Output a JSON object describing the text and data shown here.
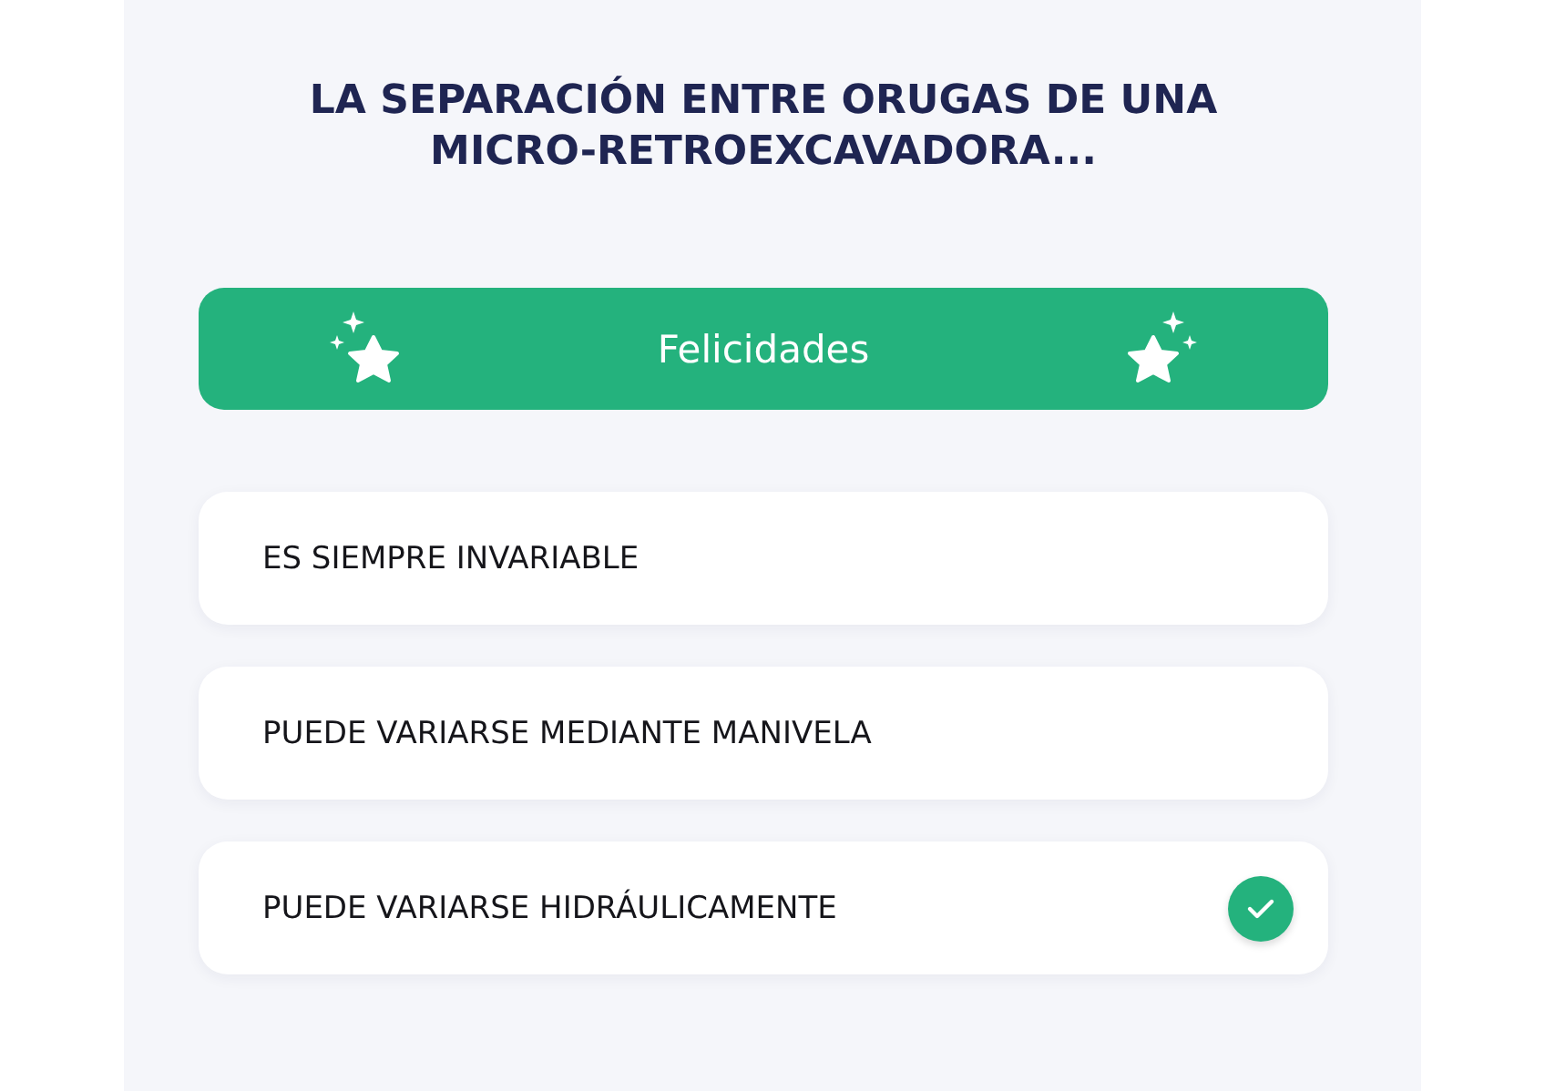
{
  "question": {
    "title": "LA SEPARACIÓN ENTRE ORUGAS DE UNA MICRO-RETROEXCAVADORA..."
  },
  "result_banner": {
    "label": "Felicidades"
  },
  "options": [
    {
      "label": "ES SIEMPRE INVARIABLE",
      "selected": false
    },
    {
      "label": "PUEDE VARIARSE MEDIANTE MANIVELA",
      "selected": false
    },
    {
      "label": "PUEDE VARIARSE HIDRÁULICAMENTE",
      "selected": true
    }
  ]
}
